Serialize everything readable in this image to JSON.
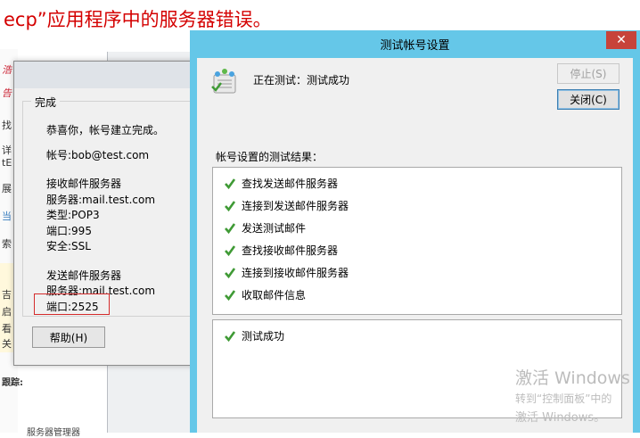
{
  "background": {
    "heading": "ecp”应用程序中的服务器错误。",
    "fragments": [
      "浩",
      "告",
      "找",
      "详",
      "tE",
      "展",
      "当",
      "索",
      "吉",
      "启",
      "看",
      "关",
      "跟踪:",
      "服务器管理器"
    ]
  },
  "complete_dialog": {
    "group_title": "完成",
    "congrats": "恭喜你，帐号建立完成。",
    "account": "帐号:bob@test.com",
    "incoming_title": "接收邮件服务器",
    "incoming_server": "服务器:mail.test.com",
    "incoming_type": "类型:POP3",
    "incoming_port": "端口:995",
    "incoming_security": "安全:SSL",
    "outgoing_title": "发送邮件服务器",
    "outgoing_server": "服务器:mail.test.com",
    "outgoing_port": "端口:2525",
    "help_button": "帮助(H)"
  },
  "test_dialog": {
    "title": "测试帐号设置",
    "close_glyph": "✕",
    "status": "正在测试：测试成功",
    "stop_button": "停止(S)",
    "close_button": "关闭(C)",
    "results_label": "帐号设置的测试结果：",
    "results": [
      "查找发送邮件服务器",
      "连接到发送邮件服务器",
      "发送测试邮件",
      "查找接收邮件服务器",
      "连接到接收邮件服务器",
      "收取邮件信息"
    ],
    "summary": "测试成功"
  },
  "watermark": {
    "line1": "激活 Windows",
    "line2": "转到“控制面板”中的",
    "line3": "激活 Windows。"
  },
  "colors": {
    "titlebar": "#65c7e8",
    "close": "#c7433a",
    "check": "#3f9a35",
    "highlight": "#d42b2b",
    "heading": "#d40000"
  }
}
